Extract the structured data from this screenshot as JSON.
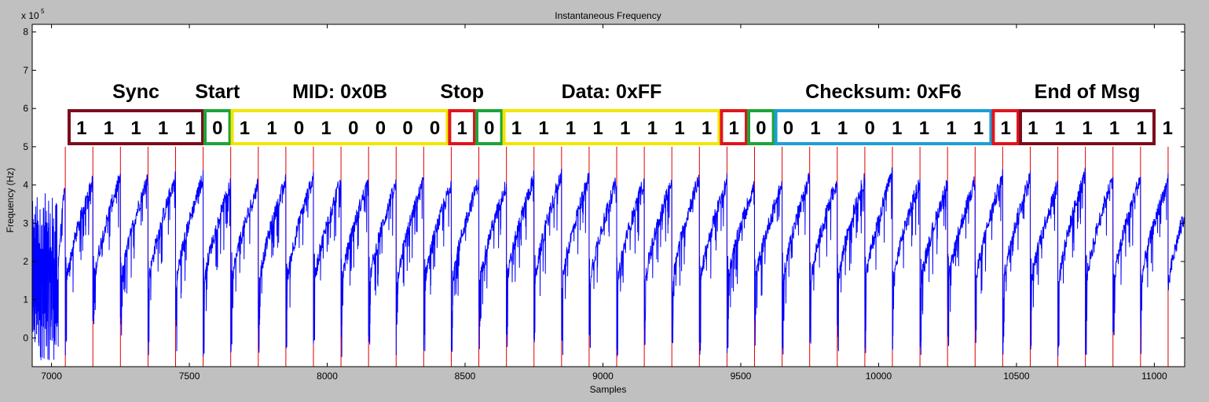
{
  "chart_data": {
    "type": "line",
    "title": "Instantaneous Frequency",
    "xlabel": "Samples",
    "ylabel": "Frequency (Hz)",
    "y_exponent_label": "x 10",
    "y_exponent_power": "5",
    "xlim": [
      6930,
      11110
    ],
    "ylim": [
      -0.75,
      8.2
    ],
    "xticks": [
      7000,
      7500,
      8000,
      8500,
      9000,
      9500,
      10000,
      10500,
      11000
    ],
    "xtick_labels": [
      "7000",
      "7500",
      "8000",
      "8500",
      "9000",
      "9500",
      "10000",
      "10500",
      "11000"
    ],
    "yticks": [
      0,
      1,
      2,
      3,
      4,
      5,
      6,
      7,
      8
    ],
    "ytick_labels": [
      "0",
      "1",
      "2",
      "3",
      "4",
      "5",
      "6",
      "7",
      "8"
    ],
    "grid": false,
    "bit_period_samples": 100,
    "bit_boundaries_start": 7050,
    "bit_boundaries_count": 41,
    "bit_marker_top": 5.0,
    "series": [
      {
        "color": "#0000ff",
        "description": "instantaneous frequency signal: sawtooth ramps rising from ~1.2 to ~4.2 (x10^5 Hz) each bit period, with sharp drops to 0 at bit boundaries and noisy bursts near 7000",
        "peak_x": [
          7050,
          7150,
          7250,
          7350,
          7450,
          7550,
          7650,
          7750,
          7850,
          7950,
          8050,
          8150,
          8250,
          8350,
          8450,
          8550,
          8650,
          8750,
          8850,
          8950,
          9050,
          9150,
          9250,
          9350,
          9450,
          9550,
          9650,
          9750,
          9850,
          9950,
          10050,
          10150,
          10250,
          10350,
          10450,
          10550,
          10650,
          10750,
          10850,
          10950,
          11050
        ],
        "peak_y": [
          4.0,
          4.1,
          4.2,
          4.2,
          4.2,
          4.2,
          4.0,
          4.0,
          4.1,
          4.2,
          4.1,
          4.1,
          4.0,
          4.1,
          4.0,
          4.1,
          4.0,
          4.2,
          4.3,
          4.2,
          4.1,
          4.1,
          4.1,
          4.2,
          4.1,
          4.0,
          4.0,
          4.2,
          4.1,
          4.2,
          4.3,
          4.1,
          4.0,
          4.1,
          4.2,
          4.2,
          4.0,
          4.3,
          4.2,
          4.2,
          4.1
        ],
        "trough_y": 1.2
      }
    ],
    "annotations": {
      "segments": [
        {
          "label": "Sync",
          "bits": [
            "1",
            "1",
            "1",
            "1",
            "1"
          ],
          "color": "#7b0c1c"
        },
        {
          "label": "Start",
          "bits": [
            "0"
          ],
          "color": "#1fa33a"
        },
        {
          "label": "MID: 0x0B",
          "bits": [
            "1",
            "1",
            "0",
            "1",
            "0",
            "0",
            "0",
            "0"
          ],
          "color": "#f2e600"
        },
        {
          "label": "Stop",
          "bits": [
            "1"
          ],
          "color": "#e0141c"
        },
        {
          "label": "",
          "bits": [
            "0"
          ],
          "color": "#1fa33a"
        },
        {
          "label": "Data: 0xFF",
          "bits": [
            "1",
            "1",
            "1",
            "1",
            "1",
            "1",
            "1",
            "1"
          ],
          "color": "#f2e600"
        },
        {
          "label": "",
          "bits": [
            "1"
          ],
          "color": "#e0141c"
        },
        {
          "label": "",
          "bits": [
            "0"
          ],
          "color": "#1fa33a"
        },
        {
          "label": "Checksum: 0xF6",
          "bits": [
            "0",
            "1",
            "1",
            "0",
            "1",
            "1",
            "1",
            "1"
          ],
          "color": "#1a9ed8"
        },
        {
          "label": "",
          "bits": [
            "1"
          ],
          "color": "#e0141c"
        },
        {
          "label": "End of Msg",
          "bits": [
            "1",
            "1",
            "1",
            "1",
            "1"
          ],
          "color": "#7b0c1c"
        }
      ],
      "trailing_bit": "1"
    }
  }
}
